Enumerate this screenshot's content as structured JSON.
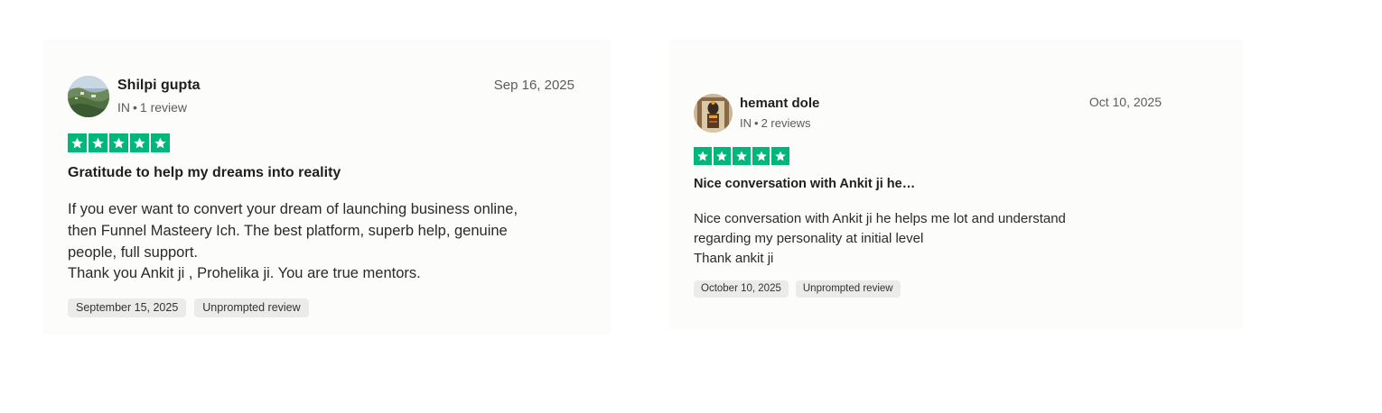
{
  "colors": {
    "star_green": "#00b67a",
    "card_background": "#fcfcfb",
    "tag_background": "#ebebea",
    "secondary_text": "#5c5c5c"
  },
  "reviews": [
    {
      "reviewer_name": "Shilpi gupta",
      "country": "IN",
      "review_count": "1 review",
      "date": "Sep 16, 2025",
      "rating": 5,
      "rating_max": 5,
      "title": "Gratitude to help my dreams into reality",
      "body_lines": [
        "If you ever want to convert your dream of launching business online,",
        "then Funnel Masteery Ich. The best platform, superb help, genuine",
        "people, full support.",
        "Thank you Ankit ji , Prohelika ji. You are true mentors."
      ],
      "experience_date": "September 15, 2025",
      "review_type": "Unprompted review",
      "avatar_icon": "landscape-photo-icon"
    },
    {
      "reviewer_name": "hemant dole",
      "country": "IN",
      "review_count": "2 reviews",
      "date": "Oct 10, 2025",
      "rating": 5,
      "rating_max": 5,
      "title": "Nice conversation with Ankit ji he…",
      "body_lines": [
        "Nice conversation with Ankit ji he helps me lot and understand",
        "regarding my personality at initial level",
        "Thank ankit ji"
      ],
      "experience_date": "October 10, 2025",
      "review_type": "Unprompted review",
      "avatar_icon": "deity-photo-icon"
    }
  ]
}
